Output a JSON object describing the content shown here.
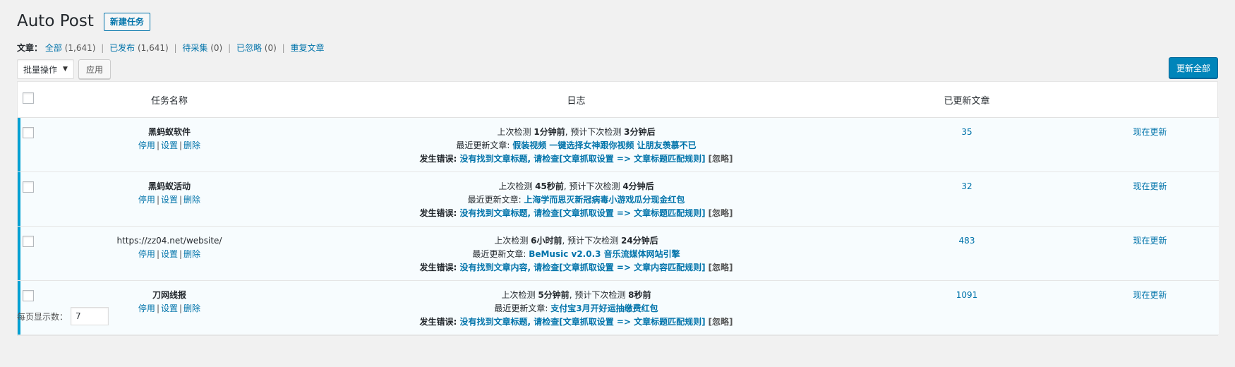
{
  "header": {
    "title": "Auto Post",
    "add_new_label": "新建任务"
  },
  "filters": {
    "label": "文章",
    "items": [
      {
        "label": "全部",
        "count": "(1,641)"
      },
      {
        "label": "已发布",
        "count": "(1,641)"
      },
      {
        "label": "待采集",
        "count": "(0)"
      },
      {
        "label": "已忽略",
        "count": "(0)"
      },
      {
        "label": "重复文章",
        "count": ""
      }
    ]
  },
  "toolbar": {
    "bulk_select_value": "批量操作",
    "apply_label": "应用",
    "update_all_label": "更新全部"
  },
  "table": {
    "columns": [
      "任务名称",
      "日志",
      "已更新文章",
      ""
    ],
    "rows": [
      {
        "name": "黑蚂蚁软件",
        "actions": [
          "停用",
          "设置",
          "删除"
        ],
        "log1_prefix": "上次检测 ",
        "log1_last": "1分钟前",
        "log1_mid": ", 预计下次检测 ",
        "log1_next": "3分钟后",
        "log2_prefix": "最近更新文章: ",
        "log2_title": "假装视频 一键选择女神跟你视频 让朋友羡慕不已",
        "log3_prefix": "发生错误: ",
        "log3_msg": "没有找到文章标题, 请检查[文章抓取设置 => 文章标题匹配规则]",
        "log3_ignore": "[忽略]",
        "count": "35",
        "update_label": "现在更新"
      },
      {
        "name": "黑蚂蚁活动",
        "actions": [
          "停用",
          "设置",
          "删除"
        ],
        "log1_prefix": "上次检测 ",
        "log1_last": "45秒前",
        "log1_mid": ", 预计下次检测 ",
        "log1_next": "4分钟后",
        "log2_prefix": "最近更新文章: ",
        "log2_title": "上海学而思灭新冠病毒小游戏瓜分现金红包",
        "log3_prefix": "发生错误: ",
        "log3_msg": "没有找到文章标题, 请检查[文章抓取设置 => 文章标题匹配规则]",
        "log3_ignore": "[忽略]",
        "count": "32",
        "update_label": "现在更新"
      },
      {
        "name": "https://zz04.net/website/",
        "actions": [
          "停用",
          "设置",
          "删除"
        ],
        "log1_prefix": "上次检测 ",
        "log1_last": "6小时前",
        "log1_mid": ", 预计下次检测 ",
        "log1_next": "24分钟后",
        "log2_prefix": "最近更新文章: ",
        "log2_title": "BeMusic v2.0.3 音乐流媒体网站引擎",
        "log3_prefix": "发生错误: ",
        "log3_msg": "没有找到文章内容, 请检查[文章抓取设置 => 文章内容匹配规则]",
        "log3_ignore": "[忽略]",
        "count": "483",
        "update_label": "现在更新"
      },
      {
        "name": "刀网线报",
        "actions": [
          "停用",
          "设置",
          "删除"
        ],
        "log1_prefix": "上次检测 ",
        "log1_last": "5分钟前",
        "log1_mid": ", 预计下次检测 ",
        "log1_next": "8秒前",
        "log2_prefix": "最近更新文章: ",
        "log2_title": "支付宝3月开好运抽缴费红包",
        "log3_prefix": "发生错误: ",
        "log3_msg": "没有找到文章标题, 请检查[文章抓取设置 => 文章标题匹配规则]",
        "log3_ignore": "[忽略]",
        "count": "1091",
        "update_label": "现在更新"
      }
    ]
  },
  "footer": {
    "per_page_label": "每页显示数：",
    "per_page_value": "7"
  },
  "colors": {
    "accent": "#0073aa",
    "primary_button": "#0085ba",
    "row_highlight": "#00a0d2"
  }
}
